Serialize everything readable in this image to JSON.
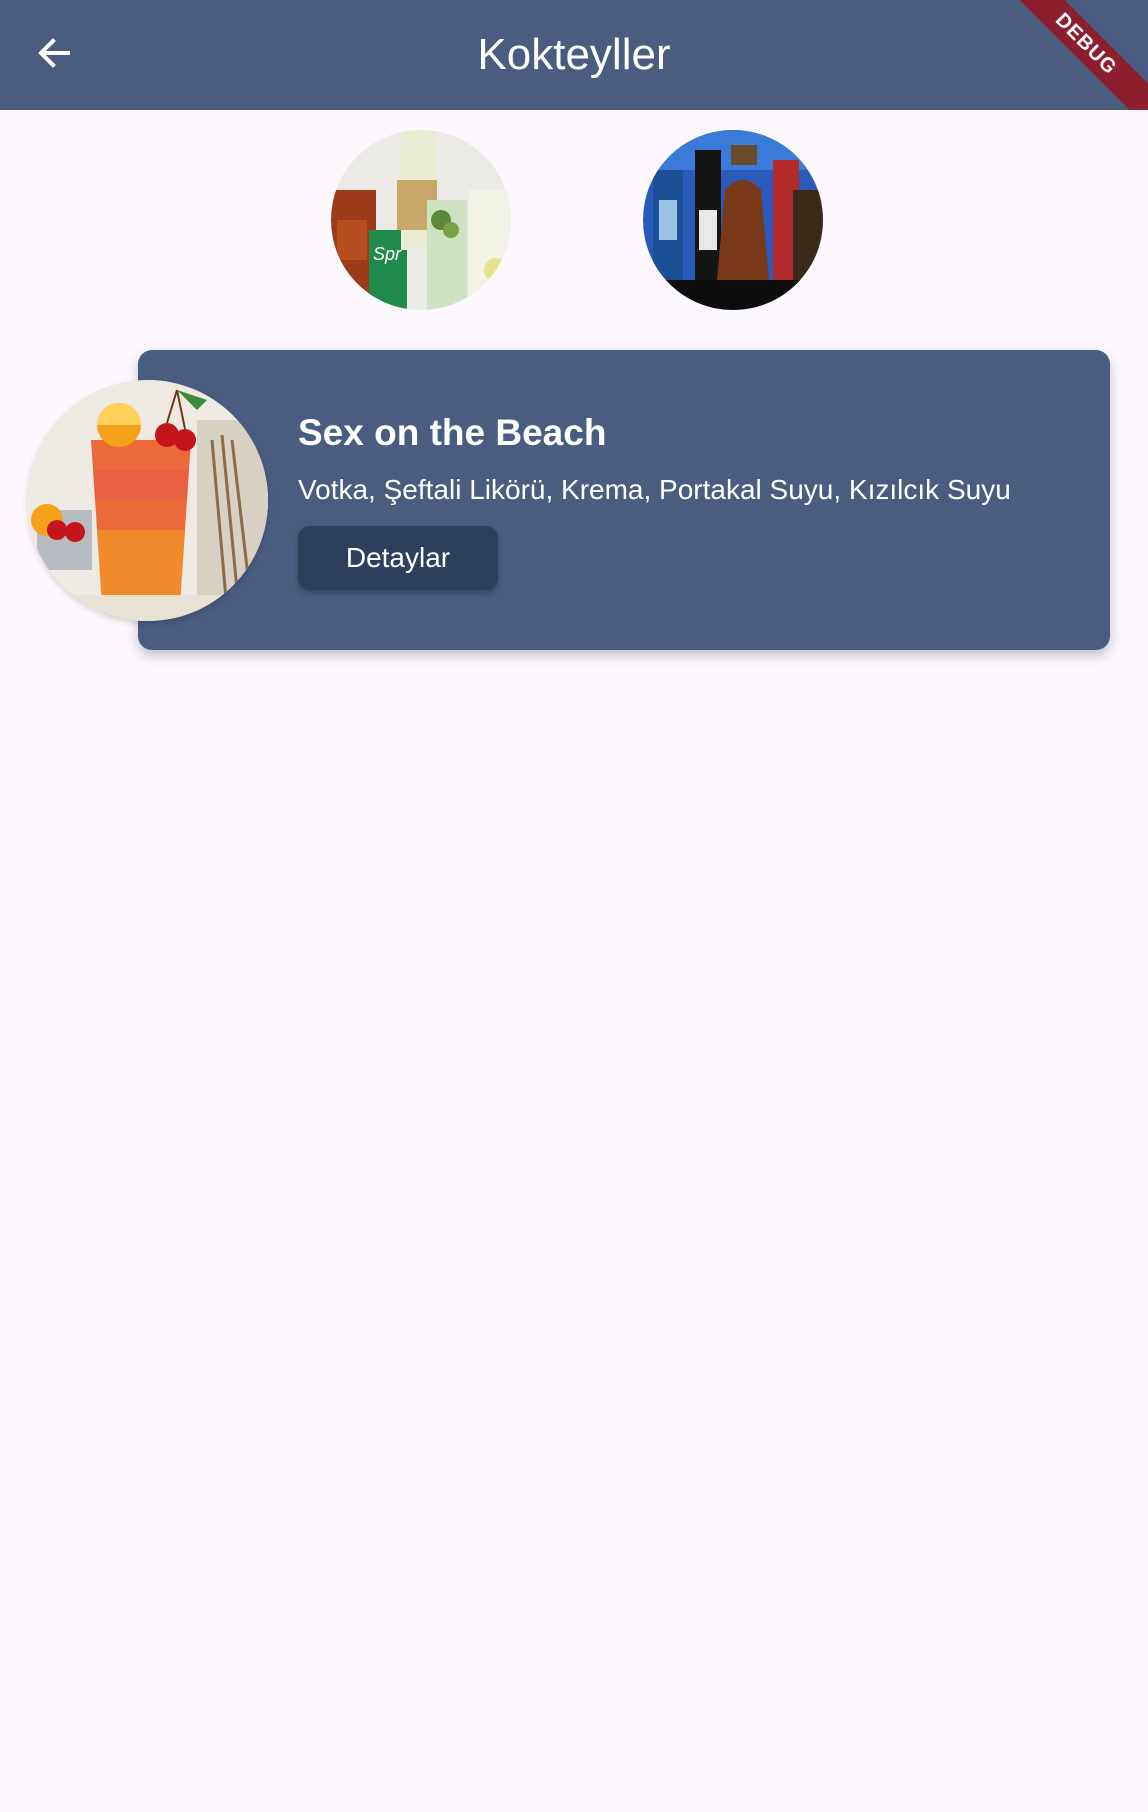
{
  "app_bar": {
    "title": "Kokteyller",
    "back_icon": "arrow-back-icon",
    "debug_label": "DEBUG"
  },
  "categories": [
    {
      "icon": "soft-drinks-image"
    },
    {
      "icon": "liquor-bottles-image"
    }
  ],
  "cocktail_card": {
    "name": "Sex on the Beach",
    "ingredients": "Votka, Şeftali Likörü, Krema, Portakal Suyu, Kızılcık Suyu",
    "details_label": "Detaylar"
  },
  "colors": {
    "app_bar": "#4a5c7f",
    "card": "#4a5c7f",
    "button": "#2e3f5e",
    "background": "#fcf8fd",
    "debug_ribbon": "#8e1f2f"
  }
}
